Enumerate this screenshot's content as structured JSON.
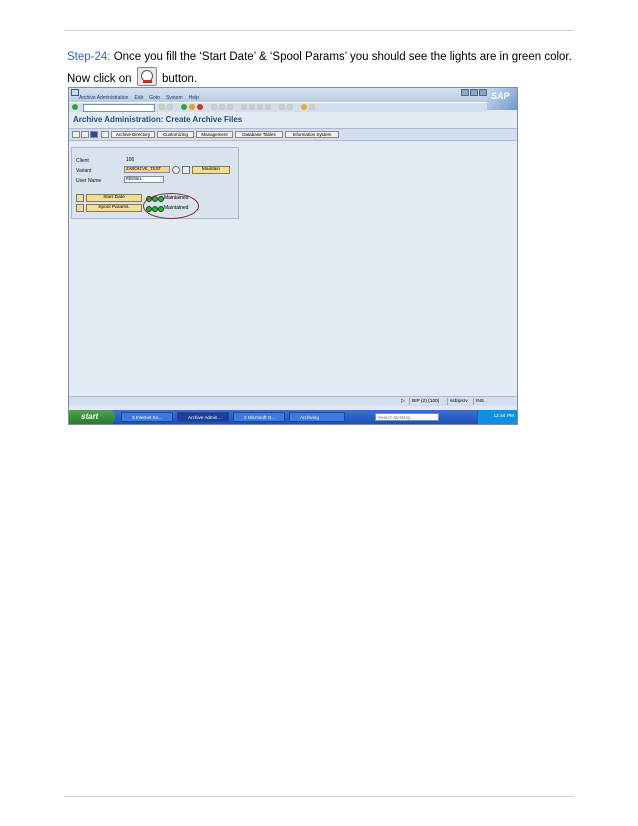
{
  "step": {
    "label": "Step-24:",
    "text_before": "Once you fill the ‘Start Date’ & ‘Spool Params’ you should see the lights are in green color. Now click on",
    "text_after": "button.",
    "icon": "execute-clock-icon"
  },
  "sap": {
    "menu": [
      "Archive Administration",
      "Edit",
      "Goto",
      "System",
      "Help"
    ],
    "logo": "SAP",
    "title": "Archive Administration: Create Archive Files",
    "app_buttons": [
      "Archive Directory",
      "Customizing",
      "Management",
      "Database Tables",
      "Information System"
    ],
    "client_label": "Client",
    "client_value": "100",
    "variant_label": "Variant",
    "variant_value": "ZARCHIVE_TEST",
    "maintain_label": "Maintain",
    "username_label": "User Name",
    "username_value": "REENUL",
    "start_date_label": "Start Date",
    "spool_label": "Spool Params.",
    "status_1": "Maintained",
    "status_2": "Maintained",
    "statusbar": {
      "system": "BIP (2) (100)",
      "server": "ssbipsrv",
      "mode": "INS"
    },
    "taskbar": {
      "start": "start",
      "tasks": [
        "3 Internet Ex...",
        "Archive Admin...",
        "2 Microsoft O...",
        "Archiving"
      ],
      "search_placeholder": "Search Desktop",
      "time": "12:44 PM"
    }
  },
  "colors": {
    "accent": "#2f63b8",
    "title": "#1f4e8a",
    "lights": "#3ea83e",
    "ellipse": "#8b2a2a"
  }
}
